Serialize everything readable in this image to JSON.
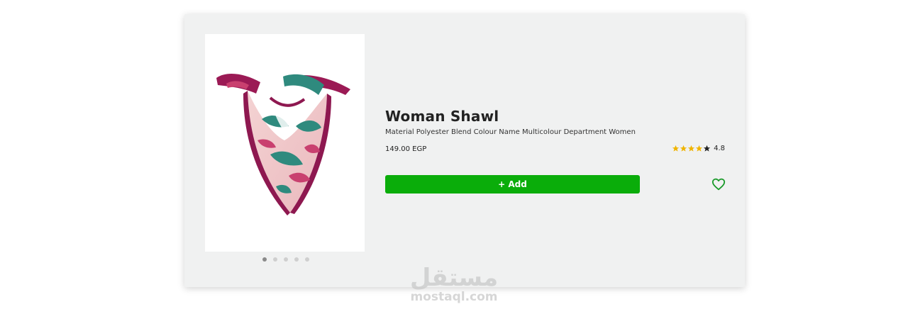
{
  "product": {
    "title": "Woman Shawl",
    "description": "Material Polyester Blend Colour Name Multicolour Department Women",
    "price": "149.00 EGP",
    "rating_value": "4.8",
    "rating_stars_filled": 4,
    "rating_stars_total": 5,
    "add_button_label": "+ Add"
  },
  "carousel": {
    "dot_count": 5,
    "active_index": 0
  },
  "colors": {
    "accent_green": "#0aad0a",
    "star_gold": "#f0b400",
    "card_bg": "#f0f1f1"
  },
  "icons": {
    "wishlist": "heart-outline-icon",
    "rating": "star-icon"
  },
  "watermark": {
    "arabic": "مستقل",
    "latin": "mostaql.com"
  }
}
